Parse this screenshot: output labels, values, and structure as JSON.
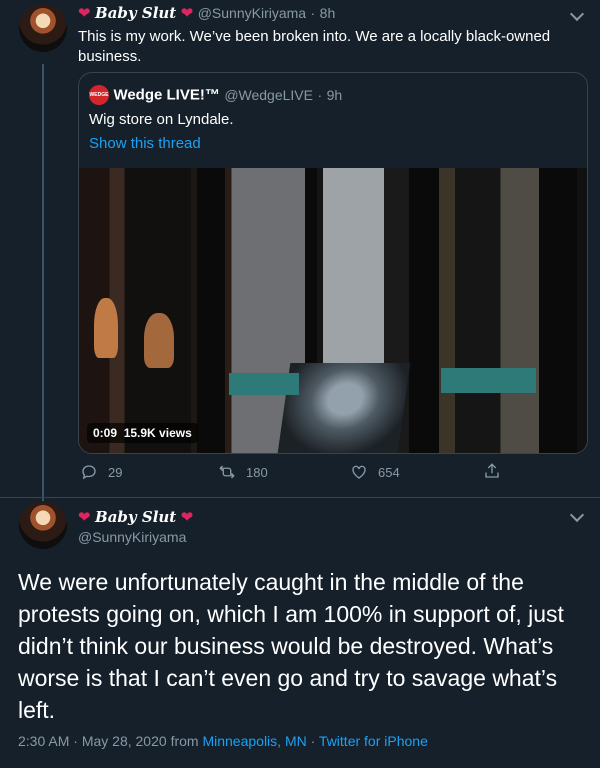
{
  "reply_tweet": {
    "display_name": "Baby Slut",
    "handle": "@SunnyKiriyama",
    "time": "8h",
    "text": "This is my work. We’ve been broken into. We are a locally black-owned business."
  },
  "quoted_tweet": {
    "display_name": "Wedge LIVE!™",
    "handle": "@WedgeLIVE",
    "time": "9h",
    "text": "Wig store on Lyndale.",
    "show_thread": "Show this thread",
    "avatar_text": "WEDGE",
    "video": {
      "duration": "0:09",
      "views": "15.9K views"
    }
  },
  "actions": {
    "replies": "29",
    "retweets": "180",
    "likes": "654"
  },
  "main_tweet": {
    "display_name": "Baby Slut",
    "handle": "@SunnyKiriyama",
    "text": "We were unfortunately caught in the middle of the protests going on, which I am 100% in support of, just didn’t think our business would be destroyed. What’s worse is that I can’t even go and try to savage what’s left.",
    "time": "2:30 AM",
    "date": "May 28, 2020",
    "from_label": "from",
    "location": "Minneapolis, MN",
    "source": "Twitter for iPhone",
    "separator": "·"
  },
  "colors": {
    "background": "#15202b",
    "accent": "#1da1f2",
    "muted": "#8899a6",
    "like": "#e0245e"
  },
  "icons": [
    "reply-icon",
    "retweet-icon",
    "like-icon",
    "share-icon",
    "chevron-down-icon",
    "heart-icon"
  ]
}
